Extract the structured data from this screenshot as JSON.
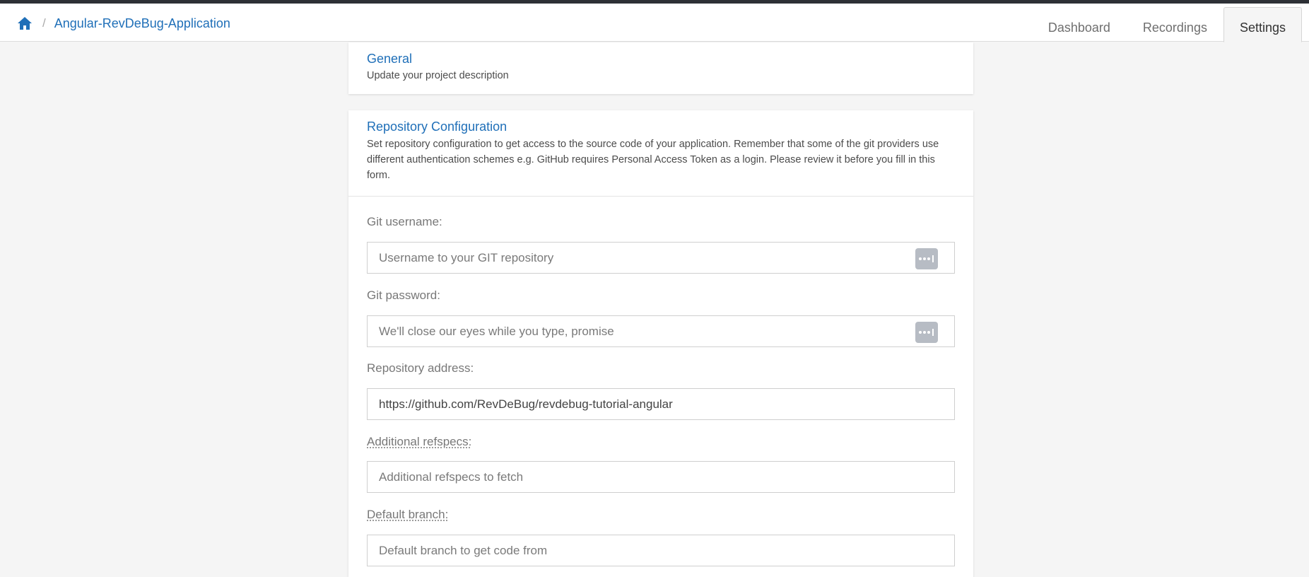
{
  "breadcrumb": {
    "home_icon": "home-icon",
    "separator": "/",
    "project": "Angular-RevDeBug-Application"
  },
  "tabs": [
    {
      "label": "Dashboard",
      "active": false
    },
    {
      "label": "Recordings",
      "active": false
    },
    {
      "label": "Settings",
      "active": true
    }
  ],
  "general": {
    "title": "General",
    "description": "Update your project description"
  },
  "repo": {
    "title": "Repository Configuration",
    "description": "Set repository configuration to get access to the source code of your application. Remember that some of the git providers use different authentication schemes e.g. GitHub requires Personal Access Token as a login. Please review it before you fill in this form.",
    "git_username": {
      "label": "Git username:",
      "placeholder": "Username to your GIT repository",
      "value": ""
    },
    "git_password": {
      "label": "Git password:",
      "placeholder": "We'll close our eyes while you type, promise",
      "value": ""
    },
    "repo_address": {
      "label": "Repository address:",
      "placeholder": "",
      "value": "https://github.com/RevDeBug/revdebug-tutorial-angular"
    },
    "refspecs": {
      "label": "Additional refspecs:",
      "placeholder": "Additional refspecs to fetch",
      "value": ""
    },
    "default_branch": {
      "label": "Default branch:",
      "placeholder": "Default branch to get code from",
      "value": ""
    }
  },
  "colors": {
    "link_blue": "#1f6fb8",
    "top_strip": "#2e3136",
    "background": "#f5f5f5",
    "password_manager_button": "#b7bcc4"
  }
}
